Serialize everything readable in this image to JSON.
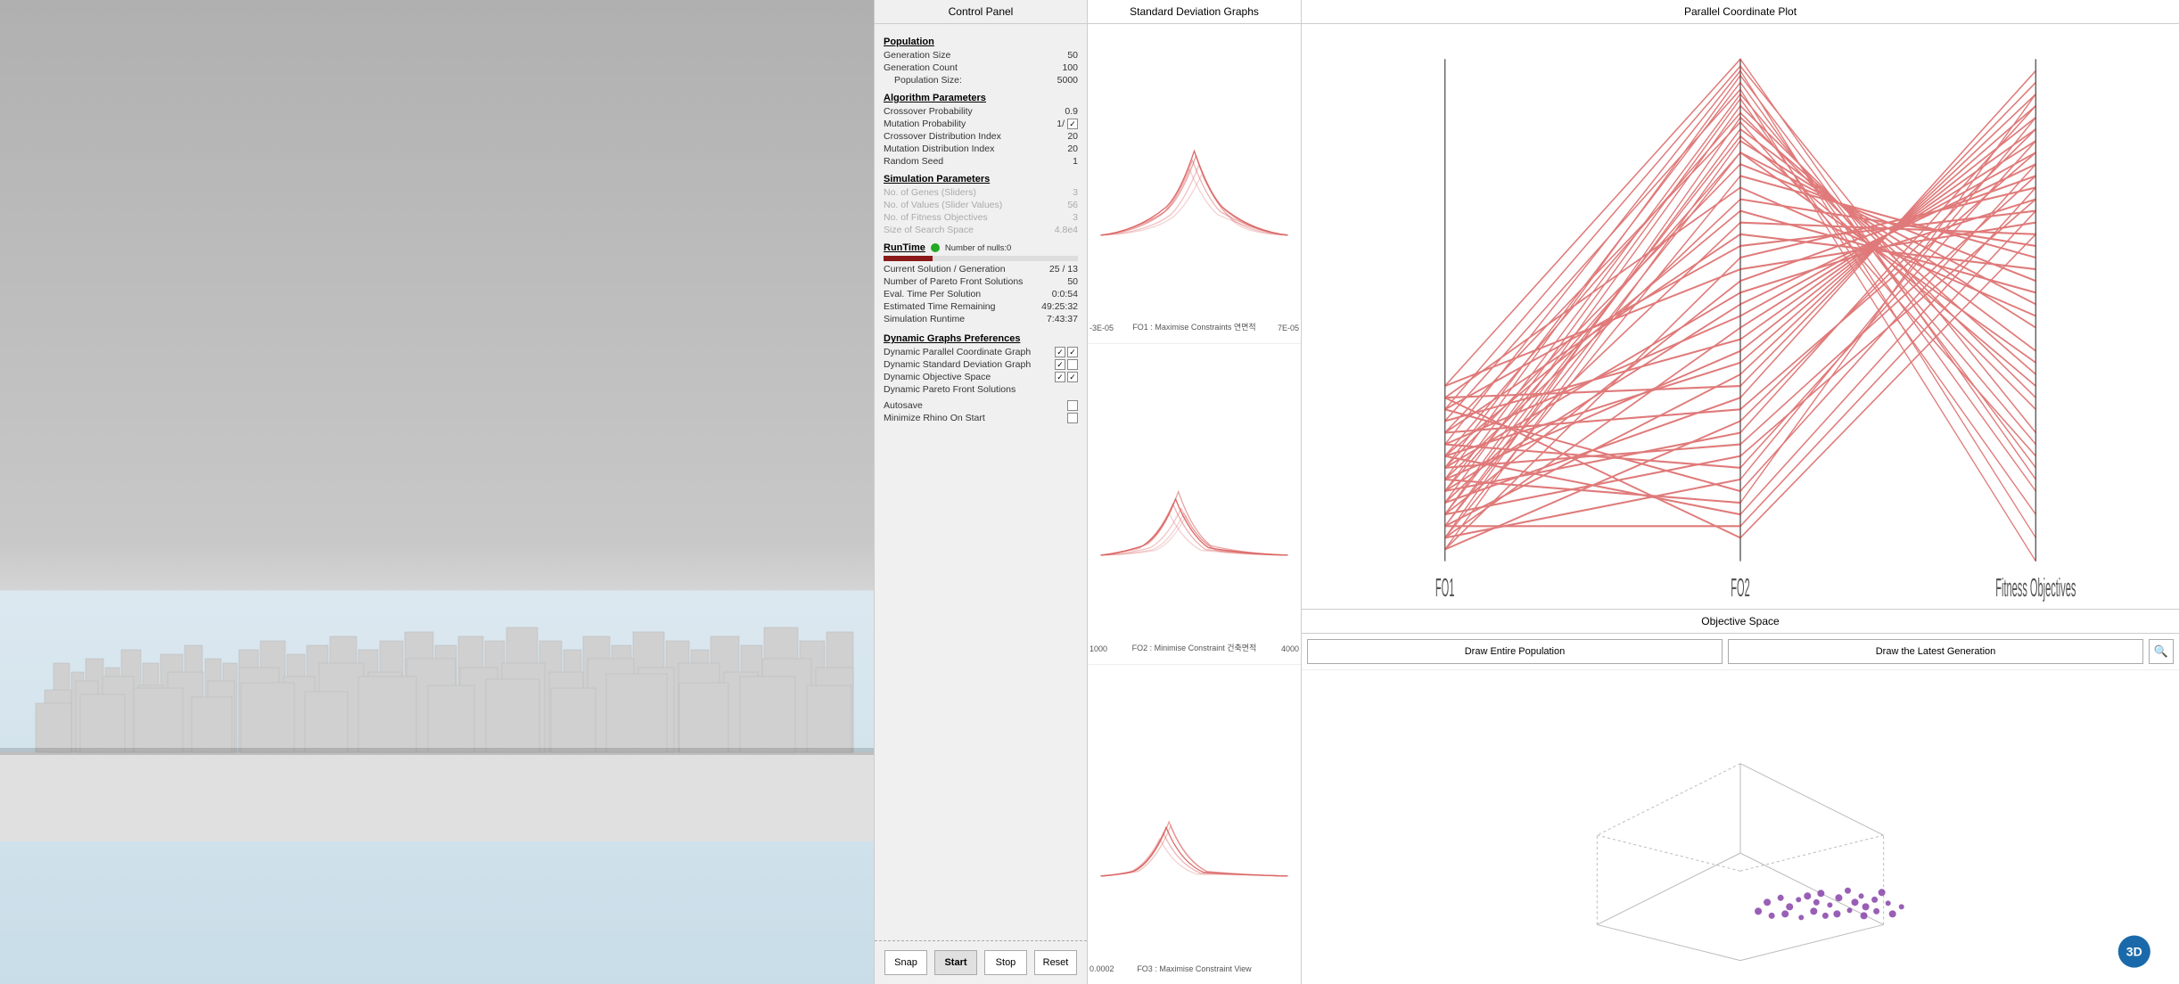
{
  "viewport": {
    "label": "3D City View"
  },
  "control_panel": {
    "header": "Control Panel",
    "population": {
      "title": "Population",
      "generation_size_label": "Generation Size",
      "generation_size_value": "50",
      "generation_count_label": "Generation Count",
      "generation_count_value": "100",
      "population_size_label": "Population Size:",
      "population_size_value": "5000"
    },
    "algorithm": {
      "title": "Algorithm Parameters",
      "crossover_prob_label": "Crossover Probability",
      "crossover_prob_value": "0.9",
      "mutation_prob_label": "Mutation Probability",
      "mutation_prob_value": "1/",
      "crossover_dist_label": "Crossover Distribution Index",
      "crossover_dist_value": "20",
      "mutation_dist_label": "Mutation Distribution Index",
      "mutation_dist_value": "20",
      "random_seed_label": "Random Seed",
      "random_seed_value": "1"
    },
    "simulation": {
      "title": "Simulation Parameters",
      "genes_label": "No. of Genes (Sliders)",
      "genes_value": "3",
      "slider_values_label": "No. of Values (Slider Values)",
      "slider_values_value": "56",
      "fitness_objectives_label": "No. of Fitness Objectives",
      "fitness_objectives_value": "3",
      "search_space_label": "Size of Search Space",
      "search_space_value": "4.8e4"
    },
    "runtime": {
      "title": "RunTime",
      "nulls_label": "Number of nulls:0",
      "current_solution_label": "Current Solution / Generation",
      "current_solution_value": "25 / 13",
      "pareto_solutions_label": "Number of Pareto Front Solutions",
      "pareto_solutions_value": "50",
      "eval_time_label": "Eval. Time Per Solution",
      "eval_time_value": "0:0:54",
      "estimated_time_label": "Estimated Time Remaining",
      "estimated_time_value": "49:25:32",
      "simulation_runtime_label": "Simulation Runtime",
      "simulation_runtime_value": "7:43:37"
    },
    "dynamic_prefs": {
      "title": "Dynamic Graphs Preferences",
      "parallel_coord_label": "Dynamic Parallel Coordinate Graph",
      "std_deviation_label": "Dynamic Standard Deviation Graph",
      "objective_space_label": "Dynamic Objective Space",
      "pareto_front_label": "Dynamic Pareto Front Solutions",
      "autosave_label": "Autosave",
      "minimize_rhino_label": "Minimize Rhino On Start"
    },
    "buttons": {
      "snap": "Snap",
      "start": "Start",
      "stop": "Stop",
      "reset": "Reset"
    }
  },
  "std_dev_graphs": {
    "header": "Standard Deviation Graphs",
    "graph1": {
      "left_label": "-3E-05",
      "right_label": "7E-05",
      "bottom_label": "FO1 : Maximise Constraints 연면적"
    },
    "graph2": {
      "left_label": "1000",
      "right_label": "4000",
      "bottom_label": "FO2 : Minimise Constraint 건축면적"
    },
    "graph3": {
      "left_label": "0.0002",
      "bottom_label": "FO3 : Maximise Constraint View"
    }
  },
  "parallel_coord": {
    "header": "Parallel Coordinate Plot",
    "x_label_left": "FO1",
    "x_label_mid": "FO2",
    "x_label_right": "Fitness Objectives"
  },
  "objective_space": {
    "header": "Objective Space",
    "draw_population_btn": "Draw Entire Population",
    "draw_latest_btn": "Draw the Latest Generation",
    "search_icon": "🔍"
  }
}
